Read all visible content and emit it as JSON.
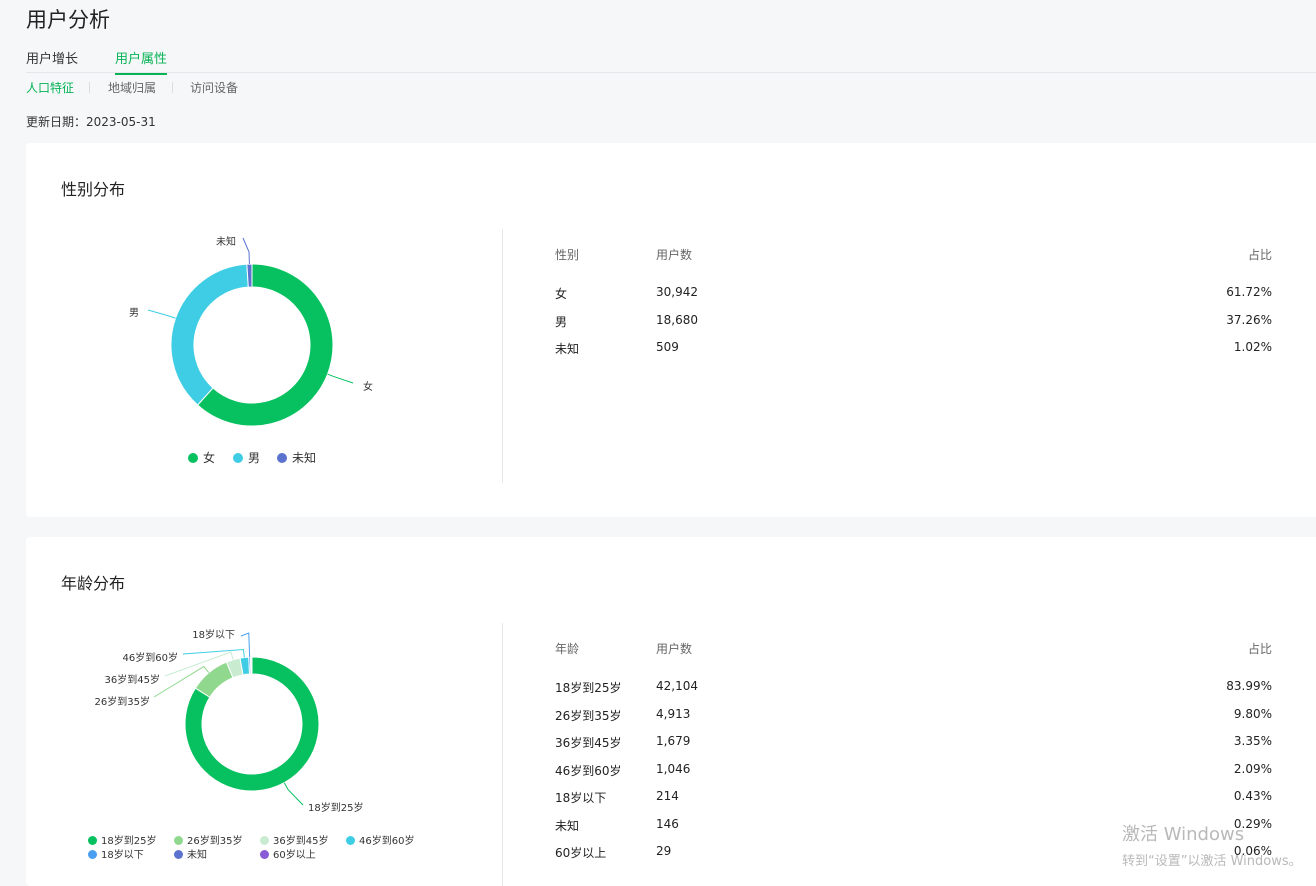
{
  "page": {
    "title": "用户分析",
    "update_label": "更新日期：",
    "update_date": "2023-05-31"
  },
  "tabs": [
    {
      "label": "用户增长",
      "active": false
    },
    {
      "label": "用户属性",
      "active": true
    }
  ],
  "subtabs": [
    {
      "label": "人口特征",
      "active": true
    },
    {
      "label": "地域归属",
      "active": false
    },
    {
      "label": "访问设备",
      "active": false
    }
  ],
  "colors": {
    "accent": "#07c160"
  },
  "gender": {
    "title": "性别分布",
    "headers": {
      "category": "性别",
      "users": "用户数",
      "ratio": "占比"
    },
    "rows": [
      {
        "label": "女",
        "users": "30,942",
        "ratio": "61.72%"
      },
      {
        "label": "男",
        "users": "18,680",
        "ratio": "37.26%"
      },
      {
        "label": "未知",
        "users": "509",
        "ratio": "1.02%"
      }
    ],
    "legend": [
      {
        "label": "女",
        "color": "#07c160"
      },
      {
        "label": "男",
        "color": "#3fcde5"
      },
      {
        "label": "未知",
        "color": "#5b73cf"
      }
    ],
    "chart_data": {
      "type": "pie",
      "categories": [
        "女",
        "男",
        "未知"
      ],
      "values": [
        30942,
        18680,
        509
      ],
      "colors": [
        "#07c160",
        "#3fcde5",
        "#5b73cf"
      ]
    }
  },
  "age": {
    "title": "年龄分布",
    "headers": {
      "category": "年龄",
      "users": "用户数",
      "ratio": "占比"
    },
    "rows": [
      {
        "label": "18岁到25岁",
        "users": "42,104",
        "ratio": "83.99%"
      },
      {
        "label": "26岁到35岁",
        "users": "4,913",
        "ratio": "9.80%"
      },
      {
        "label": "36岁到45岁",
        "users": "1,679",
        "ratio": "3.35%"
      },
      {
        "label": "46岁到60岁",
        "users": "1,046",
        "ratio": "2.09%"
      },
      {
        "label": "18岁以下",
        "users": "214",
        "ratio": "0.43%"
      },
      {
        "label": "未知",
        "users": "146",
        "ratio": "0.29%"
      },
      {
        "label": "60岁以上",
        "users": "29",
        "ratio": "0.06%"
      }
    ],
    "legend": [
      {
        "label": "18岁到25岁",
        "color": "#07c160"
      },
      {
        "label": "26岁到35岁",
        "color": "#8fd88e"
      },
      {
        "label": "36岁到45岁",
        "color": "#c9ecd1"
      },
      {
        "label": "46岁到60岁",
        "color": "#3fcde5"
      },
      {
        "label": "18岁以下",
        "color": "#4a9ef0"
      },
      {
        "label": "未知",
        "color": "#5b73cf"
      },
      {
        "label": "60岁以上",
        "color": "#8a5bd6"
      }
    ],
    "chart_data": {
      "type": "pie",
      "categories": [
        "18岁到25岁",
        "26岁到35岁",
        "36岁到45岁",
        "46岁到60岁",
        "18岁以下",
        "未知",
        "60岁以上"
      ],
      "values": [
        42104,
        4913,
        1679,
        1046,
        214,
        146,
        29
      ],
      "colors": [
        "#07c160",
        "#8fd88e",
        "#c9ecd1",
        "#3fcde5",
        "#4a9ef0",
        "#5b73cf",
        "#8a5bd6"
      ]
    }
  },
  "watermark": {
    "line1": "激活 Windows",
    "line2": "转到“设置”以激活 Windows。"
  }
}
